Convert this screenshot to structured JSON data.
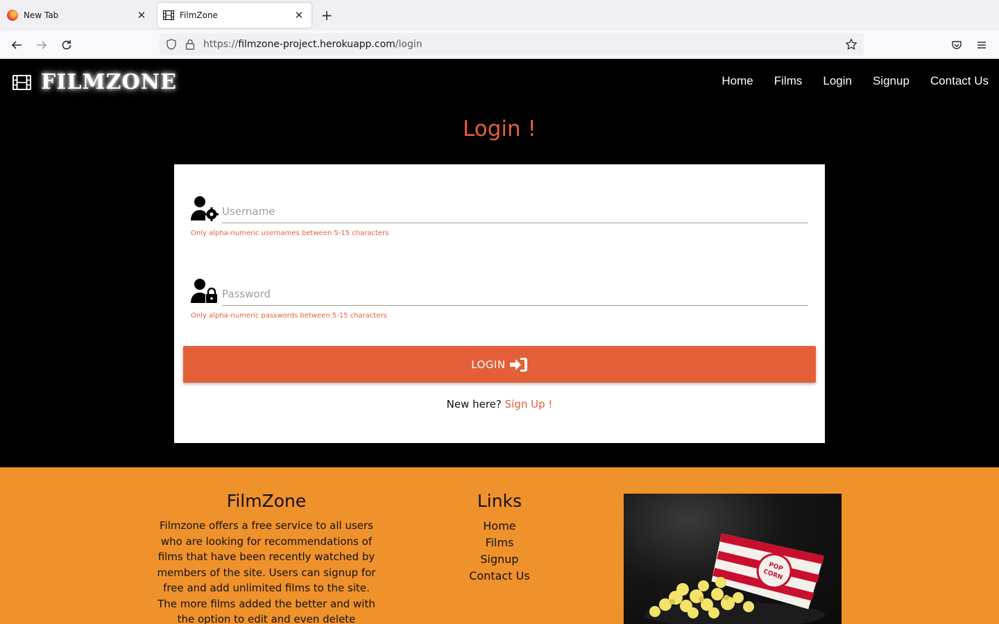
{
  "browser": {
    "tabs": [
      {
        "title": "New Tab"
      },
      {
        "title": "FilmZone"
      }
    ],
    "url": {
      "base": "https://",
      "host": "filmzone-project.herokuapp.com",
      "path": "/login"
    }
  },
  "site": {
    "brand": "FILMZONE",
    "menu": [
      "Home",
      "Films",
      "Login",
      "Signup",
      "Contact Us"
    ],
    "page_title": "Login !"
  },
  "form": {
    "username": {
      "placeholder": "Username",
      "value": "",
      "helper": "Only alpha-numeric usernames between 5-15 characters"
    },
    "password": {
      "placeholder": "Password",
      "value": "",
      "helper": "Only alpha-numeric passwords between 5-15 characters"
    },
    "login_label": "LOGIN",
    "new_here": "New here?",
    "signup_link": "Sign Up !"
  },
  "footer": {
    "about_title": "FilmZone",
    "about_text": "Filmzone offers a free service to all users who are looking for recommendations of films that have been recently watched by members of the site. Users can signup for free and add unlimited films to the site. The more films added the better and with the option to edit and even delete",
    "links_title": "Links",
    "links": [
      "Home",
      "Films",
      "Signup",
      "Contact Us"
    ],
    "image_text": "POP CORN"
  },
  "colors": {
    "accent": "#e45f38",
    "footer_bg": "#f0922c",
    "header_bg": "#000000"
  }
}
